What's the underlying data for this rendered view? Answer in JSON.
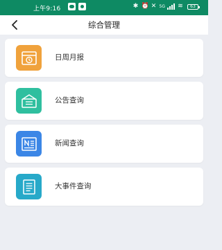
{
  "status_bar": {
    "time": "上午9:16",
    "network_label": "5G",
    "battery": "63"
  },
  "header": {
    "title": "综合管理",
    "back_icon": "chevron-left-icon"
  },
  "menu": {
    "items": [
      {
        "label": "日周月报",
        "icon": "calendar-clock-icon",
        "color": "#f0a23c"
      },
      {
        "label": "公告查询",
        "icon": "announcement-tray-icon",
        "color": "#2fbf9f"
      },
      {
        "label": "新闻查询",
        "icon": "newspaper-icon",
        "color": "#3b86e6"
      },
      {
        "label": "大事件查询",
        "icon": "document-list-icon",
        "color": "#27a9c9"
      }
    ]
  },
  "colors": {
    "status_bar_bg": "#0e8a63",
    "page_bg": "#eceef3"
  }
}
